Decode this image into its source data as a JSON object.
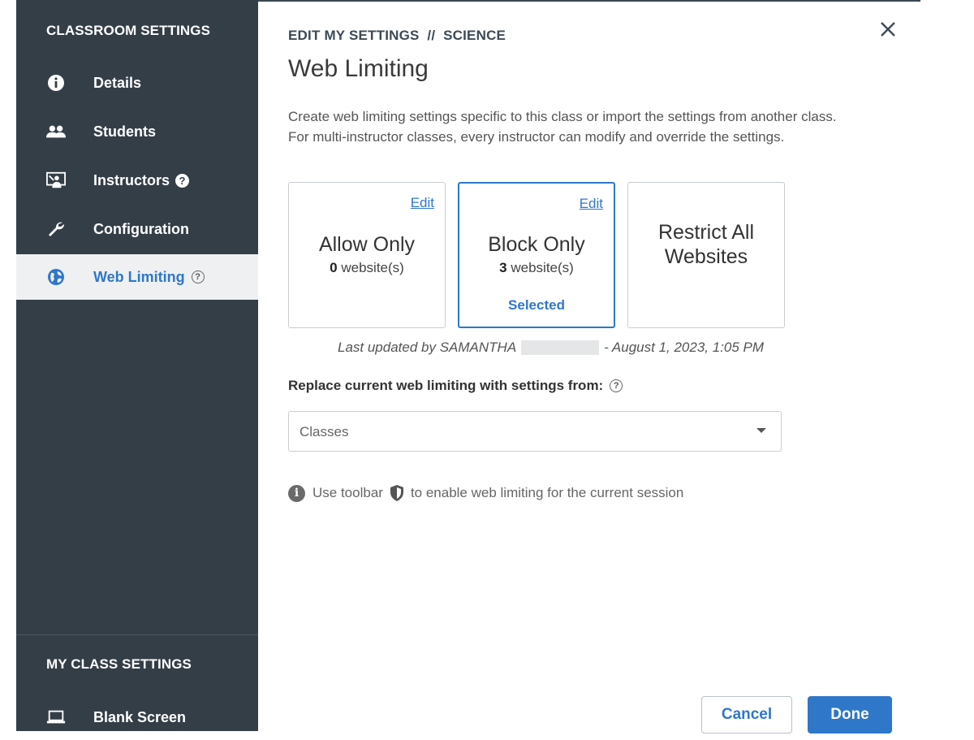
{
  "sidebar": {
    "classroom_settings_title": "CLASSROOM SETTINGS",
    "items": [
      {
        "label": "Details",
        "icon": "info-icon"
      },
      {
        "label": "Students",
        "icon": "people-icon"
      },
      {
        "label": "Instructors",
        "icon": "presenter-icon",
        "help": "?"
      },
      {
        "label": "Configuration",
        "icon": "wrench-icon"
      },
      {
        "label": "Web Limiting",
        "icon": "globe-icon",
        "help": "?",
        "active": true
      }
    ],
    "my_class_settings_title": "MY CLASS SETTINGS",
    "my_items": [
      {
        "label": "Blank Screen",
        "icon": "laptop-icon"
      }
    ]
  },
  "main": {
    "breadcrumb": "EDIT MY SETTINGS  //  SCIENCE",
    "title": "Web Limiting",
    "description_line1": "Create web limiting settings specific to this class or import the settings from another class.",
    "description_line2": "For multi-instructor classes, every instructor can modify and override the settings.",
    "cards": [
      {
        "name": "Allow Only",
        "count": "0",
        "count_suffix": " website(s)",
        "edit": "Edit"
      },
      {
        "name": "Block Only",
        "count": "3",
        "count_suffix": " website(s)",
        "edit": "Edit",
        "selected_label": "Selected"
      },
      {
        "name_line1": "Restrict All",
        "name_line2": "Websites"
      }
    ],
    "last_updated_prefix": "Last updated by SAMANTHA",
    "last_updated_suffix": "- August 1, 2023, 1:05 PM",
    "replace_label": "Replace current web limiting with settings from:",
    "help": "?",
    "select_value": "Classes",
    "hint_prefix": "Use toolbar",
    "hint_suffix": "to enable web limiting for the current session",
    "info_glyph": "i",
    "cancel_label": "Cancel",
    "done_label": "Done"
  },
  "colors": {
    "sidebar_bg": "#343e47",
    "accent": "#2f77c9"
  }
}
